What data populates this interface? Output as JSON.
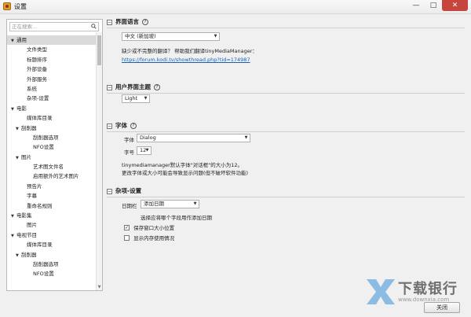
{
  "window": {
    "title": "设置",
    "minimize": "—",
    "maximize": "□",
    "close": "✕"
  },
  "sidebar": {
    "search_placeholder": "正在搜索...",
    "items": [
      {
        "label": "通用",
        "level": 0,
        "twisty": "▼",
        "selected": true
      },
      {
        "label": "文件类型",
        "level": 2
      },
      {
        "label": "标题排序",
        "level": 2
      },
      {
        "label": "外部设备",
        "level": 2
      },
      {
        "label": "外部服务",
        "level": 2
      },
      {
        "label": "系统",
        "level": 2
      },
      {
        "label": "杂项-设置",
        "level": 2
      },
      {
        "label": "电影",
        "level": 0,
        "twisty": "▼"
      },
      {
        "label": "媒体库目录",
        "level": 2
      },
      {
        "label": "刮削器",
        "level": 1,
        "twisty": "▼"
      },
      {
        "label": "刮削器选项",
        "level": 3
      },
      {
        "label": "NFO设置",
        "level": 3
      },
      {
        "label": "图片",
        "level": 1,
        "twisty": "▼"
      },
      {
        "label": "艺术图文件名",
        "level": 3
      },
      {
        "label": "启用额外的艺术图片",
        "level": 3
      },
      {
        "label": "预告片",
        "level": 2
      },
      {
        "label": "字幕",
        "level": 2
      },
      {
        "label": "重命名规则",
        "level": 2
      },
      {
        "label": "电影集",
        "level": 0,
        "twisty": "▼"
      },
      {
        "label": "图片",
        "level": 2
      },
      {
        "label": "电视节目",
        "level": 0,
        "twisty": "▼"
      },
      {
        "label": "媒体库目录",
        "level": 2
      },
      {
        "label": "刮削器",
        "level": 1,
        "twisty": "▼"
      },
      {
        "label": "刮削器选项",
        "level": 3
      },
      {
        "label": "NFO设置",
        "level": 3
      }
    ]
  },
  "ui_language": {
    "title": "界面语言",
    "help": "?",
    "language_value": "中文 (新加坡)",
    "notice": "缺少或不完整的翻译？ 帮助我们翻译tinyMediaManager：",
    "link": "https://forum.kodi.tv/showthread.php?tid=174987"
  },
  "ui_theme": {
    "title": "用户界面主题",
    "help": "?",
    "theme_value": "Light"
  },
  "font": {
    "title": "字体",
    "help": "?",
    "font_label": "字体",
    "font_value": "Dialog",
    "size_label": "字号",
    "size_value": "12",
    "hint1": "tinymediamanager默认字体\"对话框\"的大小为12。",
    "hint2": "更改字体或大小可能会导致显示问题(但不破坏软件功能)"
  },
  "misc": {
    "title": "杂项-设置",
    "date_label": "日期栏",
    "date_value": "添加日期",
    "date_hint": "选择应将哪个字段用作添加日期",
    "save_window_label": "保存窗口大小位置",
    "save_window_checked": true,
    "show_memory_label": "显示内存使用情况",
    "show_memory_checked": false
  },
  "footer": {
    "close_label": "关闭"
  },
  "watermark": {
    "title": "下载银行",
    "site": "www.downxia.com"
  }
}
